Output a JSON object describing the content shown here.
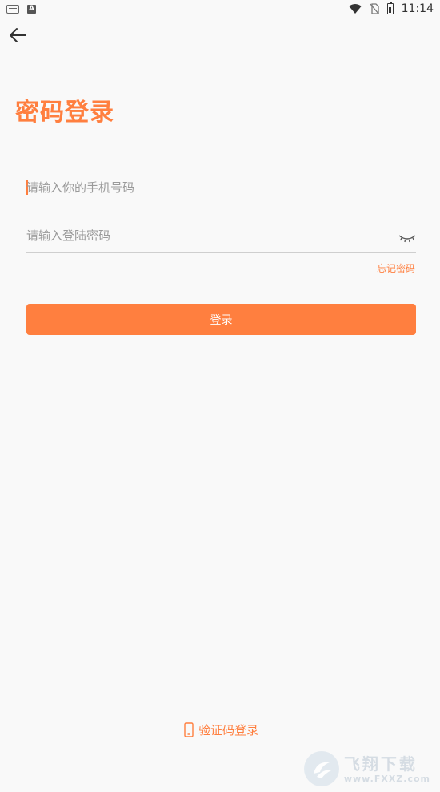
{
  "status_bar": {
    "time": "11:14",
    "app_badge": "A"
  },
  "page": {
    "title": "密码登录"
  },
  "form": {
    "phone_placeholder": "请输入你的手机号码",
    "password_placeholder": "请输入登陆密码",
    "forgot_label": "忘记密码",
    "login_label": "登录"
  },
  "footer": {
    "code_login_label": "验证码登录"
  },
  "watermark": {
    "title": "飞翔下载",
    "url": "www.FXXZ.com"
  },
  "colors": {
    "accent": "#ff7f3f",
    "background": "#f9f9f9"
  }
}
